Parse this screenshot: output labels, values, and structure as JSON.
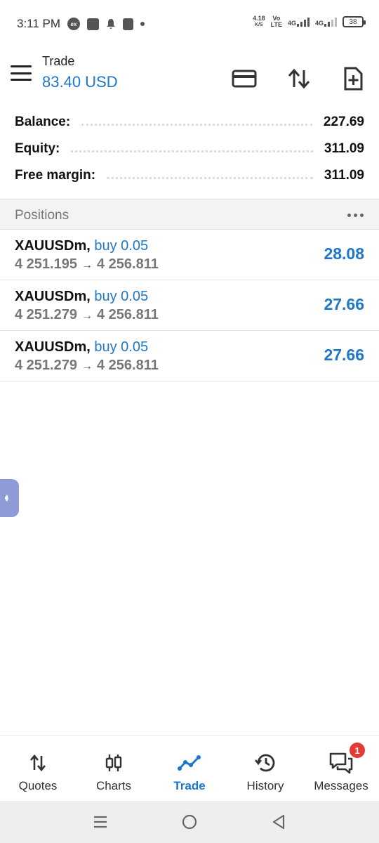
{
  "status_bar": {
    "time": "3:11 PM",
    "speed_value": "4.18",
    "speed_unit": "K/S",
    "volte_top": "Vo",
    "volte_bottom": "LTE",
    "net1": "4G",
    "net2": "4G",
    "battery": "38"
  },
  "header": {
    "title": "Trade",
    "amount": "83.40 USD"
  },
  "summary": [
    {
      "label": "Balance:",
      "value": "227.69"
    },
    {
      "label": "Equity:",
      "value": "311.09"
    },
    {
      "label": "Free margin:",
      "value": "311.09"
    }
  ],
  "positions": {
    "title": "Positions",
    "rows": [
      {
        "symbol": "XAUUSDm,",
        "side": "buy 0.05",
        "open": "4 251.195",
        "current": "4 256.811",
        "profit": "28.08"
      },
      {
        "symbol": "XAUUSDm,",
        "side": "buy 0.05",
        "open": "4 251.279",
        "current": "4 256.811",
        "profit": "27.66"
      },
      {
        "symbol": "XAUUSDm,",
        "side": "buy 0.05",
        "open": "4 251.279",
        "current": "4 256.811",
        "profit": "27.66"
      }
    ]
  },
  "bottom_nav": {
    "items": [
      {
        "label": "Quotes",
        "icon": "quotes-icon"
      },
      {
        "label": "Charts",
        "icon": "charts-icon"
      },
      {
        "label": "Trade",
        "icon": "trade-icon",
        "active": true
      },
      {
        "label": "History",
        "icon": "history-icon"
      },
      {
        "label": "Messages",
        "icon": "messages-icon",
        "badge": "1"
      }
    ]
  },
  "colors": {
    "accent": "#1e77c8",
    "badge": "#e53935"
  }
}
